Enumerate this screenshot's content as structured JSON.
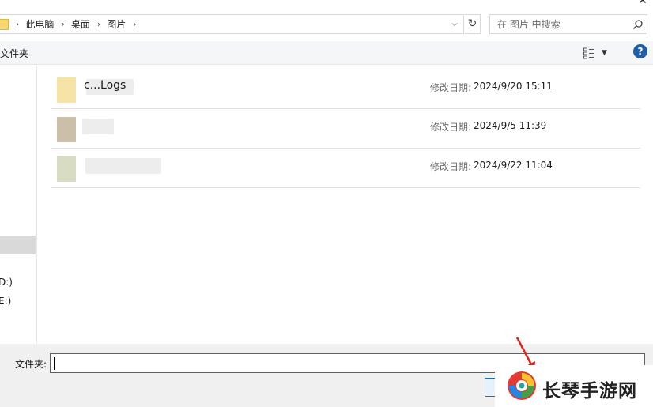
{
  "address_bar": {
    "breadcrumbs": [
      "此电脑",
      "桌面",
      "图片"
    ],
    "search_placeholder": "在 图片 中搜索"
  },
  "toolbar": {
    "new_folder_label": "文件夹",
    "help_label": "?"
  },
  "nav": {
    "drives": [
      "D:)",
      "E:)"
    ]
  },
  "files": [
    {
      "name": "c...Logs",
      "modified_label": "修改日期:",
      "modified": "2024/9/20 15:11"
    },
    {
      "name": "",
      "modified_label": "修改日期:",
      "modified": "2024/9/5 11:39"
    },
    {
      "name": "",
      "modified_label": "修改日期:",
      "modified": "2024/9/22 11:04"
    }
  ],
  "bottom": {
    "folder_label": "文件夹:",
    "folder_value": ""
  },
  "watermark": {
    "text": "长琴手游网"
  },
  "colors": {
    "accent": "#1f6fbf",
    "help_blue": "#1f5ea8",
    "folder_yellow": "#f7d774",
    "arrow_red": "#d9261c"
  }
}
